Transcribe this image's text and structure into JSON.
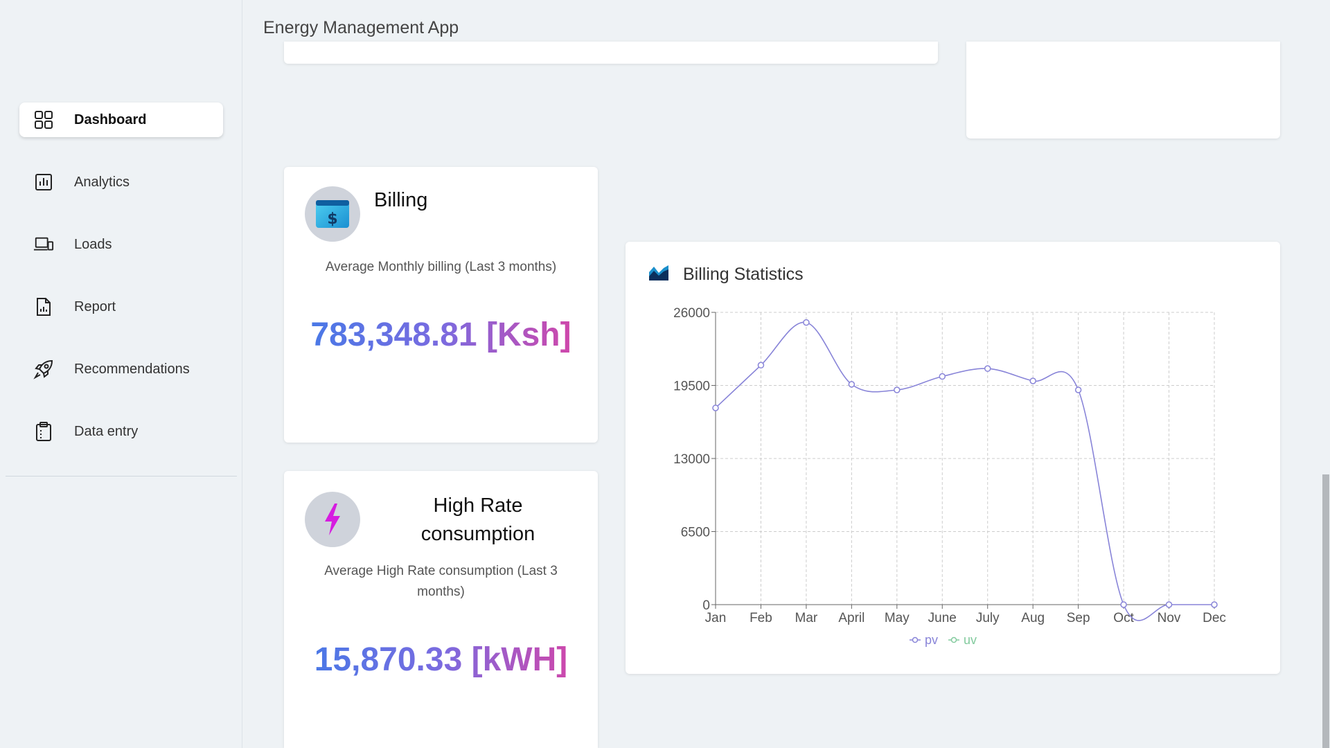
{
  "app": {
    "title": "Energy Management App"
  },
  "sidebar": {
    "items": [
      {
        "label": "Dashboard",
        "icon": "grid-icon",
        "active": true
      },
      {
        "label": "Analytics",
        "icon": "bar-chart-icon"
      },
      {
        "label": "Loads",
        "icon": "devices-icon"
      },
      {
        "label": "Report",
        "icon": "document-chart-icon"
      },
      {
        "label": "Recommendations",
        "icon": "rocket-icon"
      },
      {
        "label": "Data entry",
        "icon": "clipboard-icon"
      }
    ]
  },
  "billing": {
    "title": "Billing",
    "subtitle": "Average Monthly billing (Last 3 months)",
    "value": "783,348.81 [Ksh]",
    "icon": "billing-icon"
  },
  "high_rate": {
    "title": "High Rate consumption",
    "subtitle": "Average High Rate consumption (Last 3 months)",
    "value": "15,870.33 [kWH]",
    "icon": "lightning-icon"
  },
  "chart": {
    "title": "Billing Statistics",
    "icon": "area-chart-icon"
  },
  "chart_data": {
    "type": "line",
    "title": "Billing Statistics",
    "categories": [
      "Jan",
      "Feb",
      "Mar",
      "April",
      "May",
      "June",
      "July",
      "Aug",
      "Sep",
      "Oct",
      "Nov",
      "Dec"
    ],
    "series": [
      {
        "name": "pv",
        "color": "#8884d8",
        "values": [
          17500,
          21300,
          25100,
          19600,
          19100,
          20300,
          21000,
          19900,
          19100,
          0,
          0,
          0
        ]
      },
      {
        "name": "uv",
        "color": "#82ca9d",
        "values": []
      }
    ],
    "yticks": [
      0,
      6500,
      13000,
      19500,
      26000
    ],
    "ylim": [
      0,
      26000
    ],
    "grid": true,
    "legend_position": "bottom"
  },
  "colors": {
    "accent_start": "#3f7be8",
    "accent_end": "#e040a0",
    "pv": "#8884d8",
    "uv": "#82ca9d"
  }
}
